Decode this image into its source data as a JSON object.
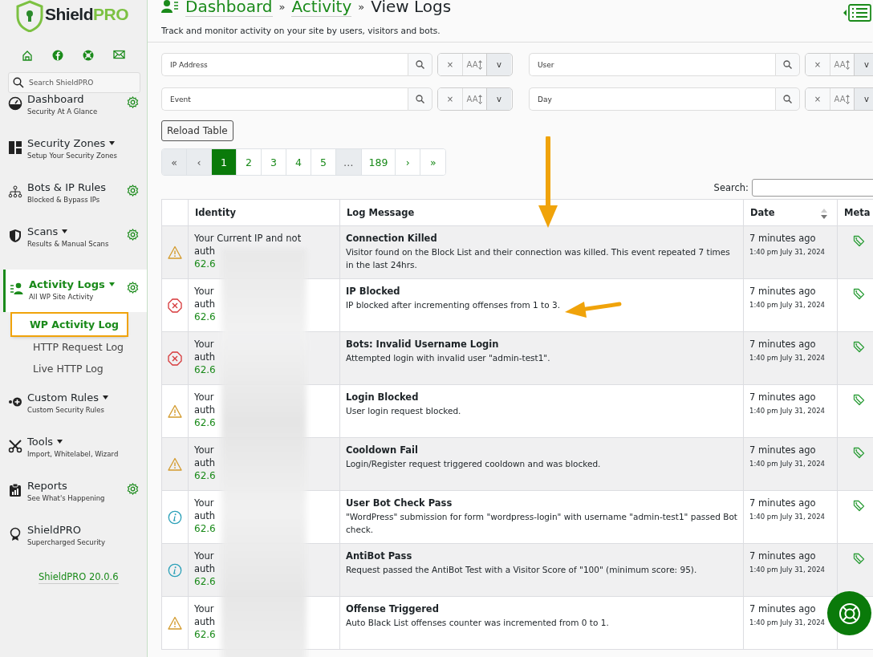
{
  "sidebar": {
    "brand": {
      "name": "Shield",
      "name_accent": "PRO"
    },
    "search": {
      "placeholder": "Search ShieldPRO"
    },
    "items": [
      {
        "title": "Dashboard",
        "subtitle": "Security At A Glance",
        "dropdown": false,
        "settings": true,
        "selected": false
      },
      {
        "title": "Security Zones",
        "subtitle": "Setup Your Security Zones",
        "dropdown": true,
        "settings": false,
        "selected": false
      },
      {
        "title": "Bots & IP Rules",
        "subtitle": "Blocked & Bypass IPs",
        "dropdown": false,
        "settings": true,
        "selected": false
      },
      {
        "title": "Scans",
        "subtitle": "Results & Manual Scans",
        "dropdown": true,
        "settings": true,
        "selected": false
      },
      {
        "title": "Activity Logs",
        "subtitle": "All WP Site Activity",
        "dropdown": true,
        "settings": true,
        "selected": true,
        "children": [
          {
            "label": "WP Activity Log",
            "selected": true,
            "highlighted": true
          },
          {
            "label": "HTTP Request Log",
            "selected": false,
            "highlighted": false
          },
          {
            "label": "Live HTTP Log",
            "selected": false,
            "highlighted": false
          }
        ]
      },
      {
        "title": "Custom Rules",
        "subtitle": "Custom Security Rules",
        "dropdown": true,
        "settings": false,
        "selected": false
      },
      {
        "title": "Tools",
        "subtitle": "Import, Whitelabel, Wizard",
        "dropdown": true,
        "settings": false,
        "selected": false
      },
      {
        "title": "Reports",
        "subtitle": "See What's Happening",
        "dropdown": false,
        "settings": true,
        "selected": false
      },
      {
        "title": "ShieldPRO",
        "subtitle": "Supercharged Security",
        "dropdown": false,
        "settings": false,
        "selected": false
      }
    ],
    "version": "ShieldPRO 20.0.6"
  },
  "header": {
    "breadcrumbs": [
      "Dashboard",
      "Activity",
      "View Logs"
    ],
    "separator": "»",
    "description": "Track and monitor activity on your site by users, visitors and bots."
  },
  "filters": [
    {
      "placeholder": "IP Address",
      "clear": "×",
      "case": "AA",
      "toggle": "v"
    },
    {
      "placeholder": "User",
      "clear": "×",
      "case": "AA",
      "toggle": "v"
    },
    {
      "placeholder": "Event",
      "clear": "×",
      "case": "AA",
      "toggle": "v"
    },
    {
      "placeholder": "Day",
      "clear": "×",
      "case": "AA",
      "toggle": "v"
    }
  ],
  "reload_button": "Reload Table",
  "pagination": [
    {
      "label": "«",
      "selected": false,
      "disabled": true
    },
    {
      "label": "‹",
      "selected": false,
      "disabled": true
    },
    {
      "label": "1",
      "selected": true,
      "disabled": false
    },
    {
      "label": "2",
      "selected": false,
      "disabled": false
    },
    {
      "label": "3",
      "selected": false,
      "disabled": false
    },
    {
      "label": "4",
      "selected": false,
      "disabled": false
    },
    {
      "label": "5",
      "selected": false,
      "disabled": false
    },
    {
      "label": "…",
      "selected": false,
      "disabled": true
    },
    {
      "label": "189",
      "selected": false,
      "disabled": false
    },
    {
      "label": "›",
      "selected": false,
      "disabled": false
    },
    {
      "label": "»",
      "selected": false,
      "disabled": false
    }
  ],
  "search_label": "Search:",
  "table": {
    "columns": [
      "Identity",
      "Log Message",
      "Date",
      "Meta"
    ],
    "rows": [
      {
        "kind": "warning",
        "identity": [
          "Your Current IP and not",
          "auth"
        ],
        "ip": "62.6",
        "title": "Connection Killed",
        "message": "Visitor found on the Block List and their connection was killed. This event repeated 7 times in the last 24hrs.",
        "ago": "7 minutes ago",
        "date": "1:40 pm July 31, 2024"
      },
      {
        "kind": "error",
        "identity": [
          "Your",
          "auth"
        ],
        "ip": "62.6",
        "title": "IP Blocked",
        "message": "IP blocked after incrementing offenses from 1 to 3.",
        "ago": "7 minutes ago",
        "date": "1:40 pm July 31, 2024"
      },
      {
        "kind": "error",
        "identity": [
          "Your",
          "auth"
        ],
        "ip": "62.6",
        "title": "Bots: Invalid Username Login",
        "message": "Attempted login with invalid user \"admin-test1\".",
        "ago": "7 minutes ago",
        "date": "1:40 pm July 31, 2024"
      },
      {
        "kind": "warning",
        "identity": [
          "Your",
          "auth"
        ],
        "ip": "62.6",
        "title": "Login Blocked",
        "message": "User login request blocked.",
        "ago": "7 minutes ago",
        "date": "1:40 pm July 31, 2024"
      },
      {
        "kind": "warning",
        "identity": [
          "Your",
          "auth"
        ],
        "ip": "62.6",
        "title": "Cooldown Fail",
        "message": "Login/Register request triggered cooldown and was blocked.",
        "ago": "7 minutes ago",
        "date": "1:40 pm July 31, 2024"
      },
      {
        "kind": "info",
        "identity": [
          "Your",
          "auth"
        ],
        "ip": "62.6",
        "title": "User Bot Check Pass",
        "message": "\"WordPress\" submission for form \"wordpress-login\" with username \"admin-test1\" passed Bot check.",
        "ago": "7 minutes ago",
        "date": "1:40 pm July 31, 2024"
      },
      {
        "kind": "info",
        "identity": [
          "Your",
          "auth"
        ],
        "ip": "62.6",
        "title": "AntiBot Pass",
        "message": "Request passed the AntiBot Test with a Visitor Score of \"100\" (minimum score: 95).",
        "ago": "7 minutes ago",
        "date": "1:40 pm July 31, 2024"
      },
      {
        "kind": "warning",
        "identity": [
          "Your",
          "auth"
        ],
        "ip": "62.6",
        "title": "Offense Triggered",
        "message": "Auto Black List offenses counter was incremented from 0 to 1.",
        "ago": "7 minutes ago",
        "date": "1:40 pm July 31, 2024"
      }
    ]
  }
}
